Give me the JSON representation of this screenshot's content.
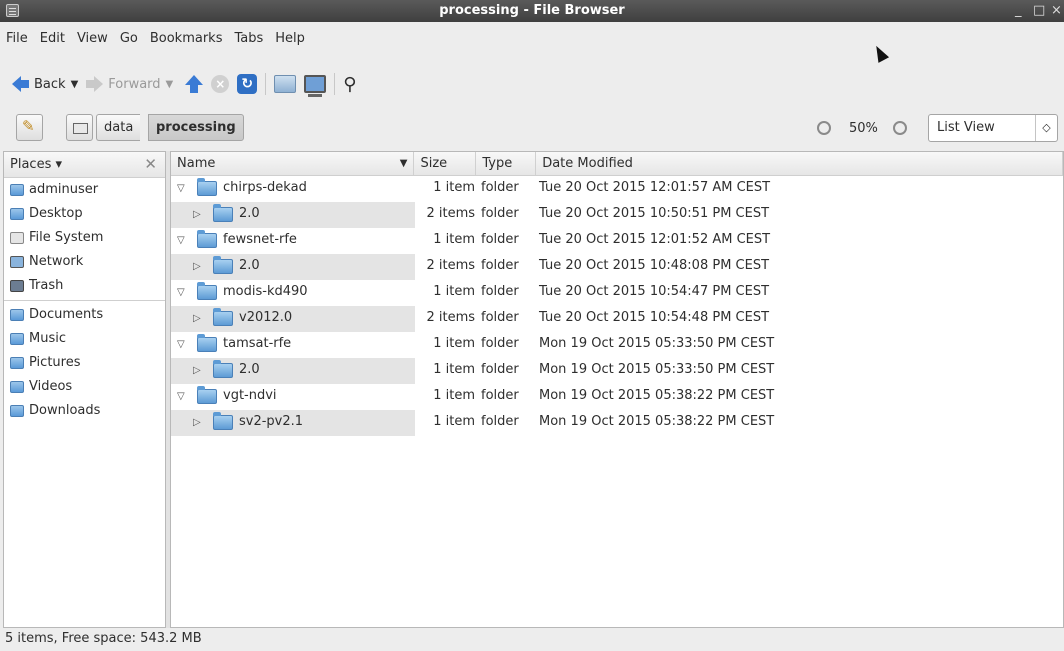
{
  "window": {
    "title": "processing - File Browser",
    "controls": {
      "minimize": "_",
      "maximize": "□",
      "close": "×"
    }
  },
  "menu": [
    "File",
    "Edit",
    "View",
    "Go",
    "Bookmarks",
    "Tabs",
    "Help"
  ],
  "toolbar": {
    "back_label": "Back",
    "forward_label": "Forward",
    "icons": [
      "back-icon",
      "forward-icon",
      "up-icon",
      "stop-icon",
      "reload-icon",
      "home-icon",
      "computer-icon",
      "search-icon"
    ]
  },
  "location": {
    "breadcrumbs": [
      "data",
      "processing"
    ],
    "zoom": "50%",
    "view_mode": "List View"
  },
  "sidebar": {
    "header": "Places",
    "items": [
      {
        "label": "adminuser",
        "icon": "home-folder-icon"
      },
      {
        "label": "Desktop",
        "icon": "desktop-folder-icon"
      },
      {
        "label": "File System",
        "icon": "filesystem-icon"
      },
      {
        "label": "Network",
        "icon": "network-icon"
      },
      {
        "label": "Trash",
        "icon": "trash-icon"
      },
      {
        "label": "Documents",
        "icon": "documents-folder-icon"
      },
      {
        "label": "Music",
        "icon": "music-folder-icon"
      },
      {
        "label": "Pictures",
        "icon": "pictures-folder-icon"
      },
      {
        "label": "Videos",
        "icon": "videos-folder-icon"
      },
      {
        "label": "Downloads",
        "icon": "downloads-folder-icon"
      }
    ]
  },
  "list": {
    "columns": [
      "Name",
      "Size",
      "Type",
      "Date Modified"
    ],
    "rows": [
      {
        "name": "chirps-dekad",
        "size": "1 item",
        "type": "folder",
        "date": "Tue 20 Oct 2015 12:01:57 AM CEST",
        "depth": 0,
        "expanded": true
      },
      {
        "name": "2.0",
        "size": "2 items",
        "type": "folder",
        "date": "Tue 20 Oct 2015 10:50:51 PM CEST",
        "depth": 1,
        "expanded": false
      },
      {
        "name": "fewsnet-rfe",
        "size": "1 item",
        "type": "folder",
        "date": "Tue 20 Oct 2015 12:01:52 AM CEST",
        "depth": 0,
        "expanded": true
      },
      {
        "name": "2.0",
        "size": "2 items",
        "type": "folder",
        "date": "Tue 20 Oct 2015 10:48:08 PM CEST",
        "depth": 1,
        "expanded": false
      },
      {
        "name": "modis-kd490",
        "size": "1 item",
        "type": "folder",
        "date": "Tue 20 Oct 2015 10:54:47 PM CEST",
        "depth": 0,
        "expanded": true
      },
      {
        "name": "v2012.0",
        "size": "2 items",
        "type": "folder",
        "date": "Tue 20 Oct 2015 10:54:48 PM CEST",
        "depth": 1,
        "expanded": false
      },
      {
        "name": "tamsat-rfe",
        "size": "1 item",
        "type": "folder",
        "date": "Mon 19 Oct 2015 05:33:50 PM CEST",
        "depth": 0,
        "expanded": true
      },
      {
        "name": "2.0",
        "size": "1 item",
        "type": "folder",
        "date": "Mon 19 Oct 2015 05:33:50 PM CEST",
        "depth": 1,
        "expanded": false
      },
      {
        "name": "vgt-ndvi",
        "size": "1 item",
        "type": "folder",
        "date": "Mon 19 Oct 2015 05:38:22 PM CEST",
        "depth": 0,
        "expanded": true
      },
      {
        "name": "sv2-pv2.1",
        "size": "1 item",
        "type": "folder",
        "date": "Mon 19 Oct 2015 05:38:22 PM CEST",
        "depth": 1,
        "expanded": false
      }
    ]
  },
  "status": "5 items, Free space: 543.2 MB"
}
